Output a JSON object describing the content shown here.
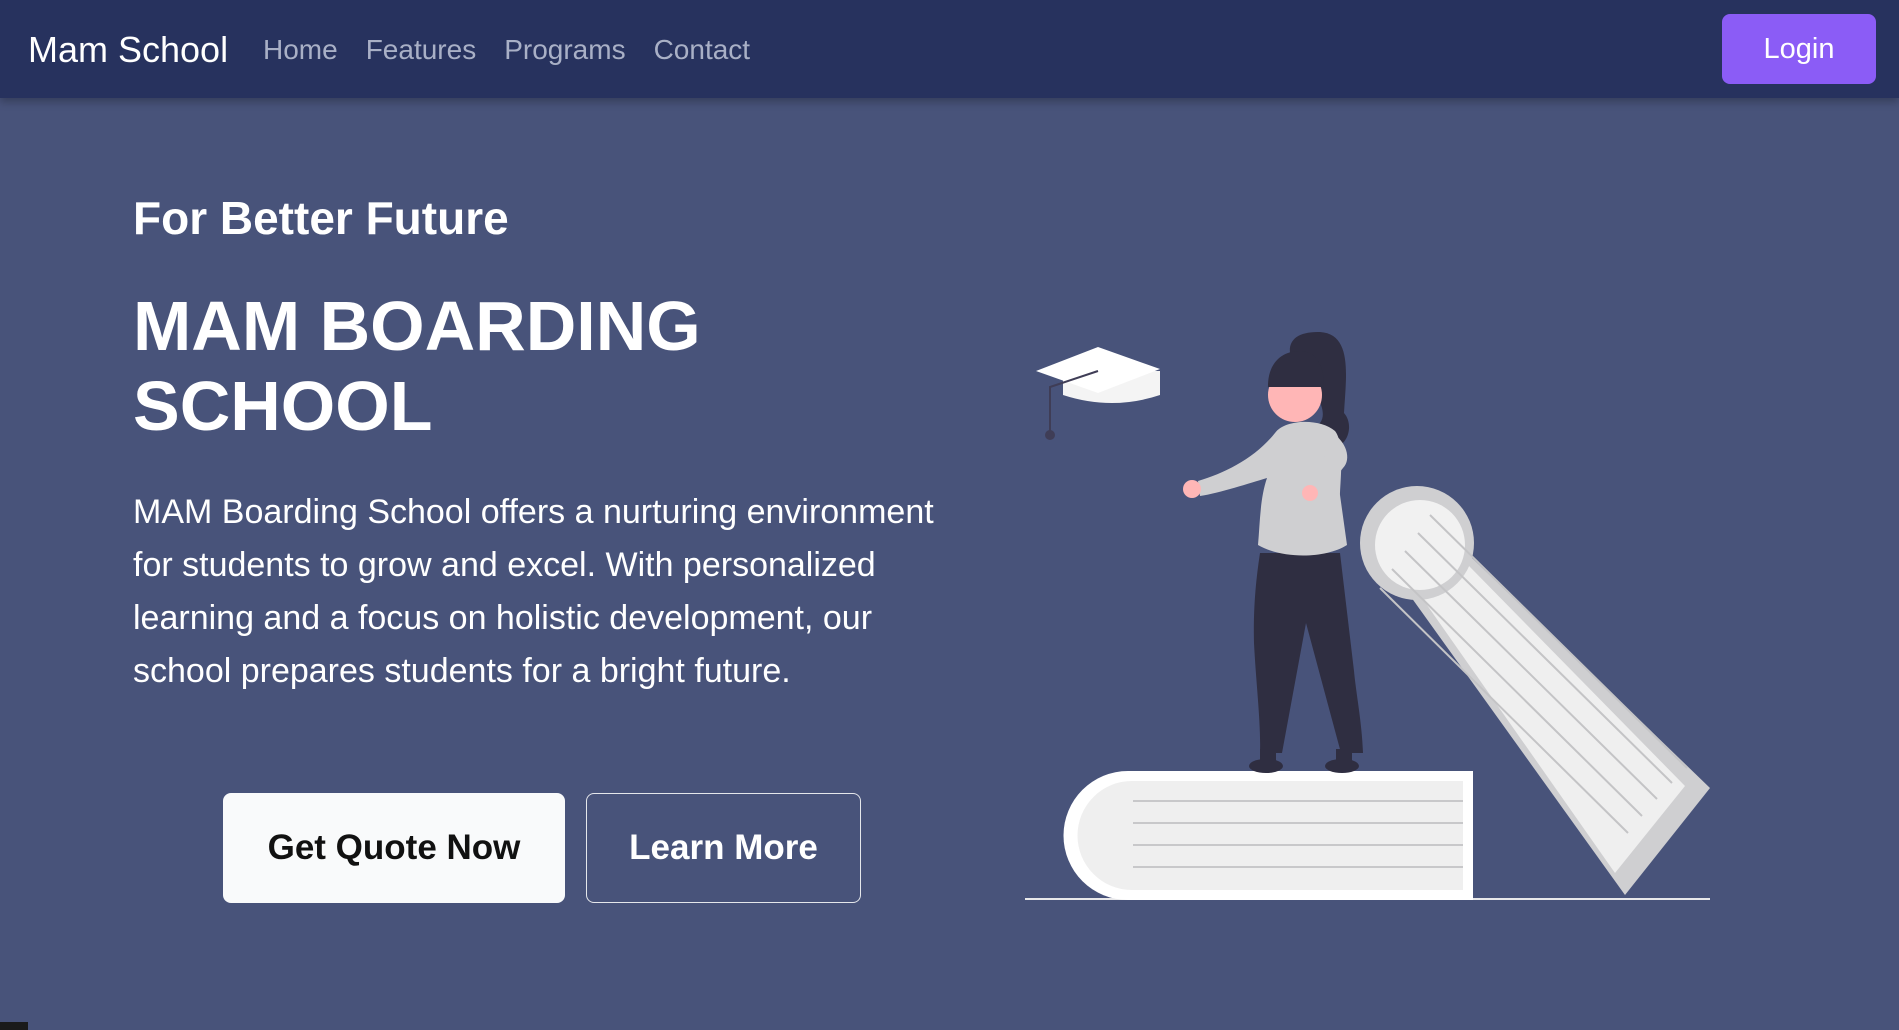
{
  "nav": {
    "brand": "Mam School",
    "links": [
      "Home",
      "Features",
      "Programs",
      "Contact"
    ],
    "login_label": "Login"
  },
  "hero": {
    "eyebrow": "For Better Future",
    "headline": "MAM BOARDING SCHOOL",
    "description": "MAM Boarding School offers a nurturing environment for students to grow and excel. With personalized learning and a focus on holistic development, our school prepares students for a bright future.",
    "primary_cta": "Get Quote Now",
    "secondary_cta": "Learn More",
    "illustration": "graduation-illustration"
  },
  "colors": {
    "navbar_bg": "#27325e",
    "hero_bg": "#48537a",
    "accent": "#8b5cf6",
    "nav_link": "#a9b0c6"
  }
}
